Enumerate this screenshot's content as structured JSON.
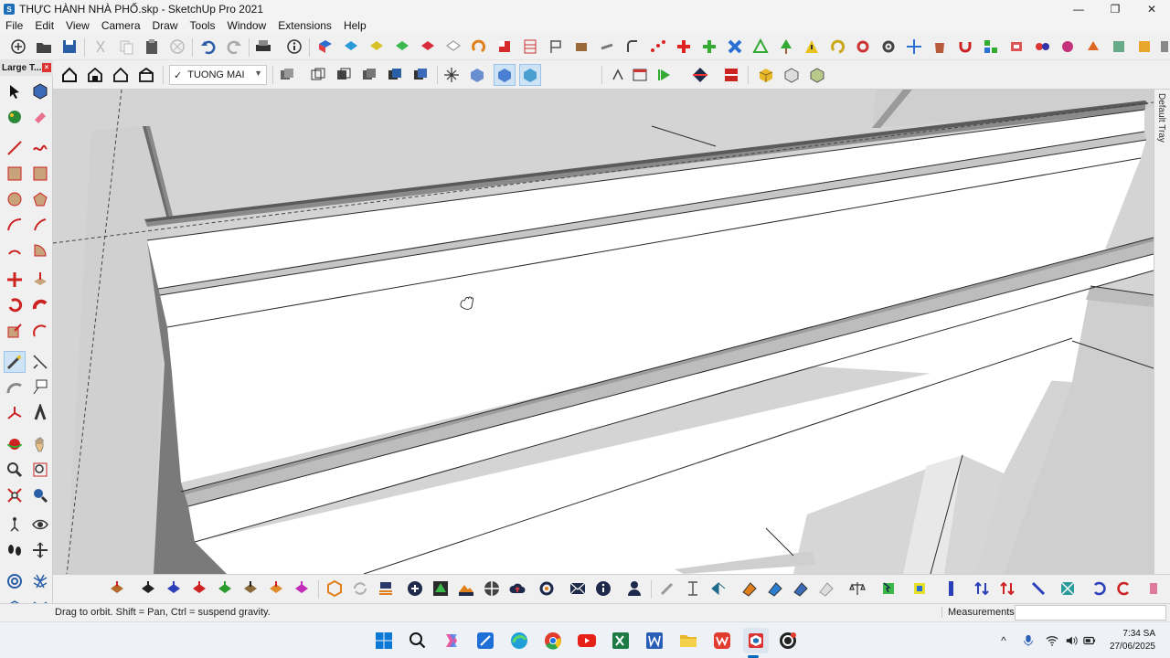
{
  "window": {
    "title": "THỰC HÀNH NHÀ PHỐ.skp - SketchUp Pro 2021",
    "minimize_glyph": "—",
    "maximize_glyph": "❐",
    "close_glyph": "✕"
  },
  "menu": {
    "items": [
      "File",
      "Edit",
      "View",
      "Camera",
      "Draw",
      "Tools",
      "Window",
      "Extensions",
      "Help"
    ]
  },
  "style_selector": {
    "value": "TUONG MAI"
  },
  "left_tray": {
    "title": "Large T...",
    "close_glyph": "×"
  },
  "right_tray": {
    "label": "Default Tray"
  },
  "status": {
    "hint": "Drag to orbit. Shift = Pan, Ctrl = suspend gravity.",
    "measurements_label": "Measurements",
    "measurements_value": ""
  },
  "clock": {
    "time": "7:34 SA",
    "date": "27/06/2025"
  },
  "colors": {
    "viewport_bg": "#d6d6d6",
    "face_white": "#ffffff",
    "face_light": "#e4e4e4",
    "face_mid": "#bdbdbd",
    "face_dark": "#7a7a7a",
    "accent_blue": "#0067c0"
  }
}
